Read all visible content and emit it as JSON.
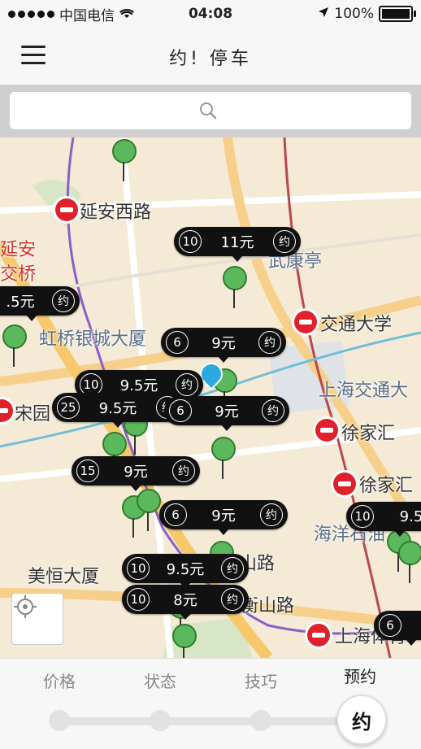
{
  "status": {
    "carrier": "中国电信",
    "time": "04:08",
    "battery": "100%"
  },
  "nav": {
    "title": "约! 停车"
  },
  "map": {
    "places": [
      {
        "name": "延安西路"
      },
      {
        "name": "武康亭"
      },
      {
        "name": "交通大学"
      },
      {
        "name": "虹桥银城大厦"
      },
      {
        "name": "上海交通大"
      },
      {
        "name": "宋园"
      },
      {
        "name": "徐家汇"
      },
      {
        "name": "徐家汇"
      },
      {
        "name": "美恒大厦"
      },
      {
        "name": "衡山路"
      },
      {
        "name": "衡山路"
      },
      {
        "name": "海洋石油"
      },
      {
        "name": "上海体育"
      },
      {
        "name": "延安"
      },
      {
        "name": "交桥"
      }
    ],
    "lots": [
      {
        "count": "10",
        "price": "11元",
        "yue": "约"
      },
      {
        "count": "",
        "price": ".5元",
        "yue": "约"
      },
      {
        "count": "6",
        "price": "9元",
        "yue": "约"
      },
      {
        "count": "10",
        "price": "9.5元",
        "yue": "约"
      },
      {
        "count": "25",
        "price": "9.5元",
        "yue": "约"
      },
      {
        "count": "6",
        "price": "9元",
        "yue": "约"
      },
      {
        "count": "15",
        "price": "9元",
        "yue": "约"
      },
      {
        "count": "6",
        "price": "9元",
        "yue": "约"
      },
      {
        "count": "10",
        "price": "9.5元",
        "yue": "约"
      },
      {
        "count": "10",
        "price": "8元",
        "yue": "约"
      },
      {
        "count": "10",
        "price": "9.5",
        "yue": ""
      },
      {
        "count": "6",
        "price": "",
        "yue": ""
      }
    ]
  },
  "tabs": [
    {
      "label": "价格"
    },
    {
      "label": "状态"
    },
    {
      "label": "技巧"
    },
    {
      "label": "预约"
    }
  ],
  "action": {
    "label": "约"
  }
}
